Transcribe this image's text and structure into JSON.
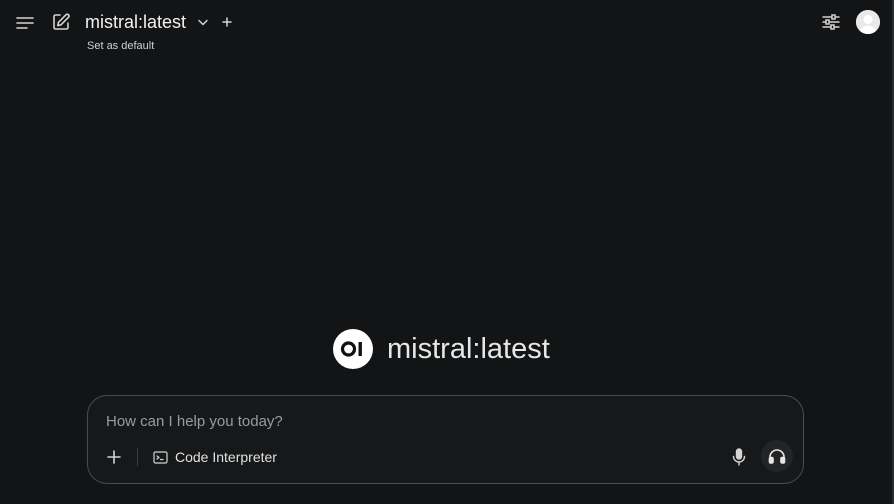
{
  "header": {
    "model_name": "mistral:latest",
    "set_default_label": "Set as default"
  },
  "hero": {
    "logo_text": "OI",
    "model_name": "mistral:latest"
  },
  "composer": {
    "placeholder": "How can I help you today?",
    "value": "",
    "tool_label": "Code Interpreter"
  },
  "icons": {
    "menu": "menu-icon",
    "new_chat": "pencil-square-icon",
    "model_dropdown": "chevron-down-icon",
    "add_model": "plus-icon",
    "controls": "sliders-icon",
    "avatar": "user-avatar",
    "attach": "plus-icon",
    "tool": "terminal-icon",
    "mic": "microphone-icon",
    "voice": "headphones-icon"
  },
  "colors": {
    "background": "#131415",
    "composer_border": "#4a4b4e",
    "text": "#e8e8e8",
    "placeholder": "#9a9b9e"
  }
}
